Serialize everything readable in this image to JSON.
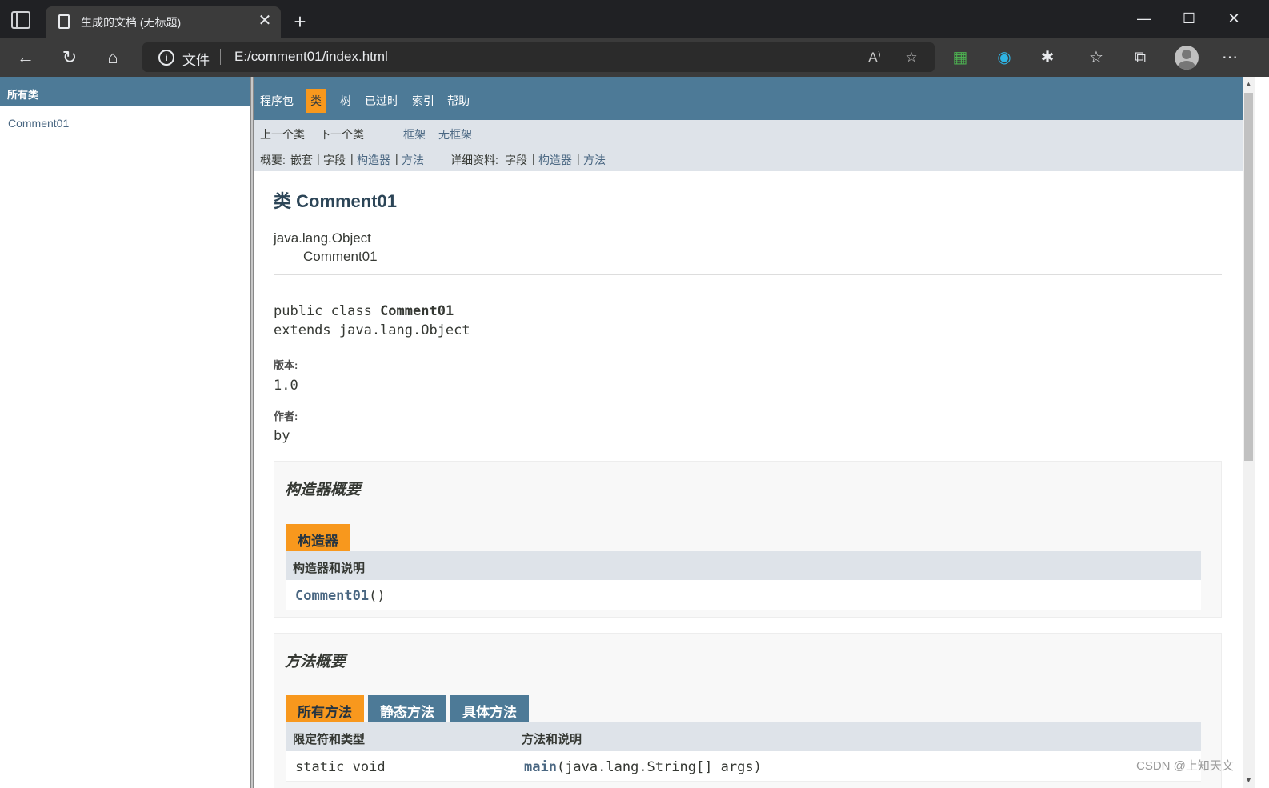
{
  "browser": {
    "tab_title": "生成的文档 (无标题)",
    "address_label": "文件",
    "url": "E:/comment01/index.html"
  },
  "left_frame": {
    "header": "所有类",
    "items": [
      "Comment01"
    ]
  },
  "topnav": {
    "items": [
      "程序包",
      "类",
      "树",
      "已过时",
      "索引",
      "帮助"
    ],
    "active": "类"
  },
  "subnav": {
    "prev_class": "上一个类",
    "next_class": "下一个类",
    "frames": "框架",
    "no_frames": "无框架",
    "summary_label": "概要:",
    "summary_nested": "嵌套",
    "summary_field": "字段",
    "summary_constructor": "构造器",
    "summary_method": "方法",
    "detail_label": "详细资料:",
    "detail_field": "字段",
    "detail_constructor": "构造器",
    "detail_method": "方法",
    "sep": "|"
  },
  "class_doc": {
    "title": "类 Comment01",
    "inheritance": [
      "java.lang.Object",
      "Comment01"
    ],
    "decl_prefix": "public class ",
    "decl_name": "Comment01",
    "decl_extends": "extends java.lang.Object",
    "version_label": "版本:",
    "version_value": "1.0",
    "author_label": "作者:",
    "author_value": "by"
  },
  "constructor_summary": {
    "title": "构造器概要",
    "caption": "构造器",
    "header": "构造器和说明",
    "rows": [
      {
        "name": "Comment01",
        "params": "()"
      }
    ]
  },
  "method_summary": {
    "title": "方法概要",
    "tabs": [
      "所有方法",
      "静态方法",
      "具体方法"
    ],
    "headers": [
      "限定符和类型",
      "方法和说明"
    ],
    "rows": [
      {
        "modifier": "static void",
        "name": "main",
        "params": "(java.lang.String[] args)"
      }
    ]
  },
  "watermark": "CSDN @上知天文"
}
